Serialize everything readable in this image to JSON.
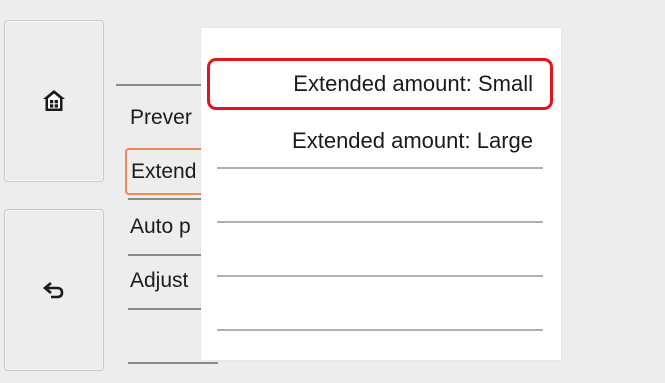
{
  "side_buttons": {
    "home_icon": "home-icon",
    "back_icon": "back-arrow-icon"
  },
  "menu": {
    "items": [
      {
        "label": "Prever"
      },
      {
        "label": "Extend",
        "selected": true
      },
      {
        "label": "Auto p"
      },
      {
        "label": "Adjust"
      }
    ]
  },
  "popup": {
    "options": [
      {
        "label": "Extended amount: Small",
        "highlighted": true
      },
      {
        "label": "Extended amount: Large",
        "highlighted": false
      }
    ]
  },
  "colors": {
    "background": "#eeedee",
    "highlight_border": "#e4141b",
    "selected_border": "#ee8a53"
  }
}
